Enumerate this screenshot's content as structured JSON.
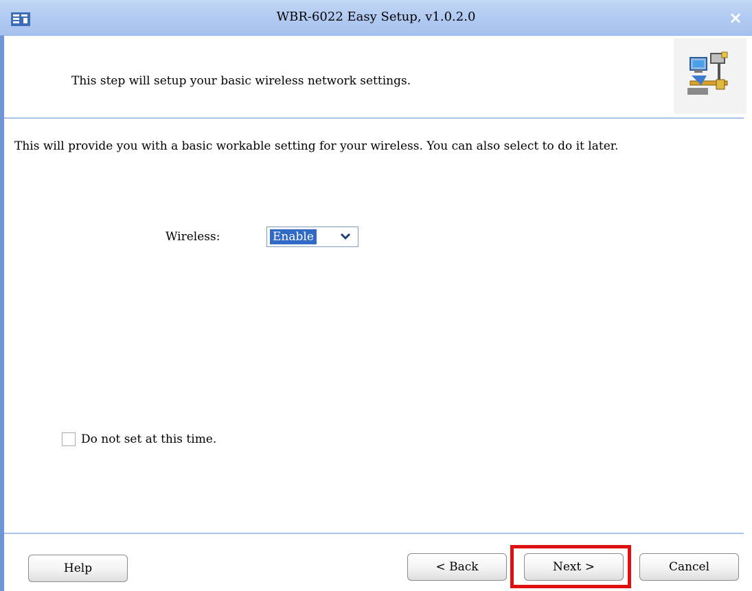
{
  "window": {
    "title": "WBR-6022 Easy Setup, v1.0.2.0"
  },
  "header": {
    "text": "This step will setup your basic wireless network settings."
  },
  "body": {
    "description": "This will provide you with a basic workable setting for your wireless. You can also select to do it later.",
    "wireless_label": "Wireless:",
    "wireless_value": "Enable",
    "checkbox_label": "Do not set at this time."
  },
  "buttons": {
    "help": "Help",
    "back": "< Back",
    "next": "Next >",
    "cancel": "Cancel"
  },
  "icons": {
    "close": "×",
    "app": "app-icon",
    "network": "network-computers-icon"
  },
  "colors": {
    "titlebar": "#b2cbf2",
    "selection": "#316ac5",
    "highlight_box": "#e01010"
  }
}
